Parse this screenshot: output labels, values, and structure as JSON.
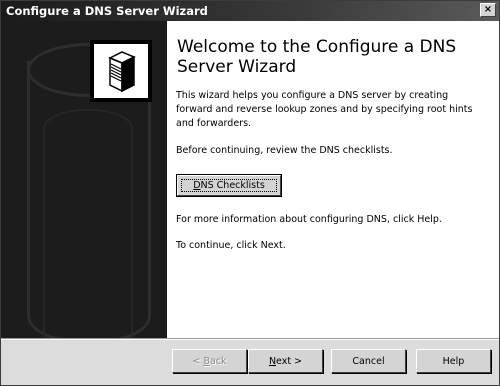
{
  "window": {
    "title": "Configure a DNS Server Wizard",
    "close_icon": "×"
  },
  "icons": {
    "close": "close-icon",
    "server": "server-icon",
    "sidebar_graphic": "cylinder-graphic"
  },
  "main": {
    "title": "Welcome to the Configure a DNS Server Wizard",
    "intro": "This wizard helps you configure a DNS server by creating forward and reverse lookup zones and by specifying root hints and forwarders.",
    "review_text": "Before continuing, review the DNS checklists.",
    "checklists_button": {
      "label_mnemonic": "D",
      "label_rest": "NS Checklists"
    },
    "help_text": "For more information about configuring DNS, click Help.",
    "continue_text": "To continue, click Next."
  },
  "footer": {
    "back_button": {
      "prefix": "< ",
      "mnemonic": "B",
      "rest": "ack",
      "enabled": false
    },
    "next_button": {
      "mnemonic": "N",
      "rest": "ext >",
      "enabled": true
    },
    "cancel_button": {
      "label": "Cancel"
    },
    "help_button": {
      "label": "Help"
    }
  },
  "colors": {
    "titlebar": "#1b1b1b",
    "side_panel": "#1c1c1c",
    "content_bg": "#ffffff",
    "dialog_bg": "#dcdcdc",
    "disabled_text": "#8a8a8a"
  }
}
